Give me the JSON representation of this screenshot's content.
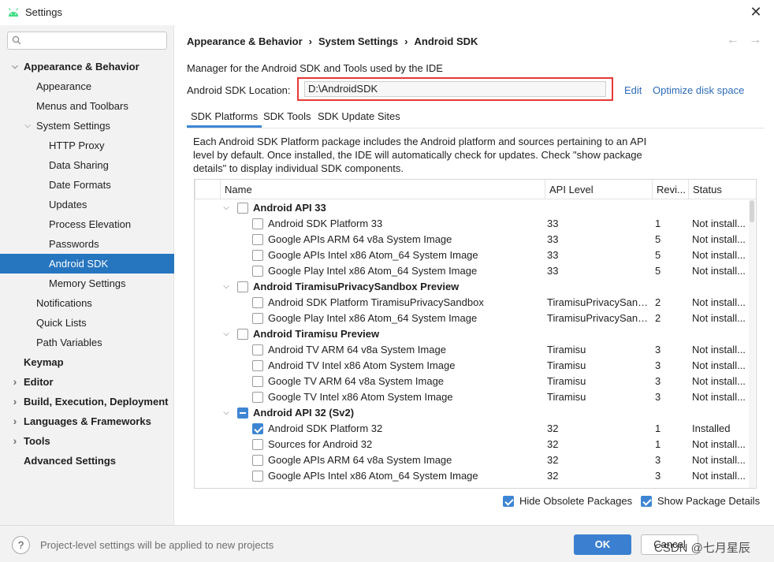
{
  "window": {
    "title": "Settings",
    "close": "✕"
  },
  "search": {
    "placeholder": "",
    "value": ""
  },
  "sidebar": {
    "items": [
      {
        "label": "Appearance & Behavior",
        "arrow": "⌵"
      },
      {
        "label": "Appearance"
      },
      {
        "label": "Menus and Toolbars"
      },
      {
        "label": "System Settings",
        "arrow": "⌵"
      },
      {
        "label": "HTTP Proxy"
      },
      {
        "label": "Data Sharing"
      },
      {
        "label": "Date Formats"
      },
      {
        "label": "Updates"
      },
      {
        "label": "Process Elevation"
      },
      {
        "label": "Passwords"
      },
      {
        "label": "Android SDK"
      },
      {
        "label": "Memory Settings"
      },
      {
        "label": "Notifications"
      },
      {
        "label": "Quick Lists"
      },
      {
        "label": "Path Variables"
      },
      {
        "label": "Keymap"
      },
      {
        "label": "Editor",
        "arrow": "›"
      },
      {
        "label": "Build, Execution, Deployment",
        "arrow": "›"
      },
      {
        "label": "Languages & Frameworks",
        "arrow": "›"
      },
      {
        "label": "Tools",
        "arrow": "›"
      },
      {
        "label": "Advanced Settings"
      }
    ]
  },
  "breadcrumb": {
    "part1": "Appearance & Behavior",
    "part2": "System Settings",
    "part3": "Android SDK",
    "sep": "›"
  },
  "nav": {
    "back": "←",
    "forward": "→"
  },
  "main": {
    "description": "Manager for the Android SDK and Tools used by the IDE",
    "location_label": "Android SDK Location:",
    "location_value": "D:\\AndroidSDK",
    "edit_link": "Edit",
    "optimize_link": "Optimize disk space"
  },
  "tabs": [
    {
      "label": "SDK Platforms"
    },
    {
      "label": "SDK Tools"
    },
    {
      "label": "SDK Update Sites"
    }
  ],
  "package_description": "Each Android SDK Platform package includes the Android platform and sources pertaining to an API level by default. Once installed, the IDE will automatically check for updates. Check \"show package details\" to display individual SDK components.",
  "table": {
    "headers": {
      "name": "Name",
      "api": "API Level",
      "rev": "Revi...",
      "status": "Status"
    },
    "rows": [
      {
        "name": "Android API 33",
        "api": "",
        "rev": "",
        "status": "",
        "group": true,
        "expander": "⌵",
        "check": "none"
      },
      {
        "name": "Android SDK Platform 33",
        "api": "33",
        "rev": "1",
        "status": "Not install...",
        "group": false,
        "check": "none"
      },
      {
        "name": "Google APIs ARM 64 v8a System Image",
        "api": "33",
        "rev": "5",
        "status": "Not install...",
        "group": false,
        "check": "none"
      },
      {
        "name": "Google APIs Intel x86 Atom_64 System Image",
        "api": "33",
        "rev": "5",
        "status": "Not install...",
        "group": false,
        "check": "none"
      },
      {
        "name": "Google Play Intel x86 Atom_64 System Image",
        "api": "33",
        "rev": "5",
        "status": "Not install...",
        "group": false,
        "check": "none"
      },
      {
        "name": "Android TiramisuPrivacySandbox Preview",
        "api": "",
        "rev": "",
        "status": "",
        "group": true,
        "expander": "⌵",
        "check": "none"
      },
      {
        "name": "Android SDK Platform TiramisuPrivacySandbox",
        "api": "TiramisuPrivacySand...",
        "rev": "2",
        "status": "Not install...",
        "group": false,
        "check": "none"
      },
      {
        "name": "Google Play Intel x86 Atom_64 System Image",
        "api": "TiramisuPrivacySand...",
        "rev": "2",
        "status": "Not install...",
        "group": false,
        "check": "none"
      },
      {
        "name": "Android Tiramisu Preview",
        "api": "",
        "rev": "",
        "status": "",
        "group": true,
        "expander": "⌵",
        "check": "none"
      },
      {
        "name": "Android TV ARM 64 v8a System Image",
        "api": "Tiramisu",
        "rev": "3",
        "status": "Not install...",
        "group": false,
        "check": "none"
      },
      {
        "name": "Android TV Intel x86 Atom System Image",
        "api": "Tiramisu",
        "rev": "3",
        "status": "Not install...",
        "group": false,
        "check": "none"
      },
      {
        "name": "Google TV ARM 64 v8a System Image",
        "api": "Tiramisu",
        "rev": "3",
        "status": "Not install...",
        "group": false,
        "check": "none"
      },
      {
        "name": "Google TV Intel x86 Atom System Image",
        "api": "Tiramisu",
        "rev": "3",
        "status": "Not install...",
        "group": false,
        "check": "none"
      },
      {
        "name": "Android API 32 (Sv2)",
        "api": "",
        "rev": "",
        "status": "",
        "group": true,
        "expander": "⌵",
        "check": "partial"
      },
      {
        "name": "Android SDK Platform 32",
        "api": "32",
        "rev": "1",
        "status": "Installed",
        "group": false,
        "check": "checked"
      },
      {
        "name": "Sources for Android 32",
        "api": "32",
        "rev": "1",
        "status": "Not install...",
        "group": false,
        "check": "none"
      },
      {
        "name": "Google APIs ARM 64 v8a System Image",
        "api": "32",
        "rev": "3",
        "status": "Not install...",
        "group": false,
        "check": "none"
      },
      {
        "name": "Google APIs Intel x86 Atom_64 System Image",
        "api": "32",
        "rev": "3",
        "status": "Not install...",
        "group": false,
        "check": "none"
      }
    ]
  },
  "options": {
    "hide_obsolete": "Hide Obsolete Packages",
    "show_details": "Show Package Details"
  },
  "footer": {
    "help": "?",
    "message": "Project-level settings will be applied to new projects",
    "ok": "OK",
    "cancel": "Cancel",
    "watermark": "CSDN @七月星辰"
  },
  "colors": {
    "selection": "#2675bf",
    "link": "#2e6bb8",
    "highlight_box": "#e53935",
    "checkbox": "#3e86d3",
    "ok_button": "#3b7fd0"
  }
}
